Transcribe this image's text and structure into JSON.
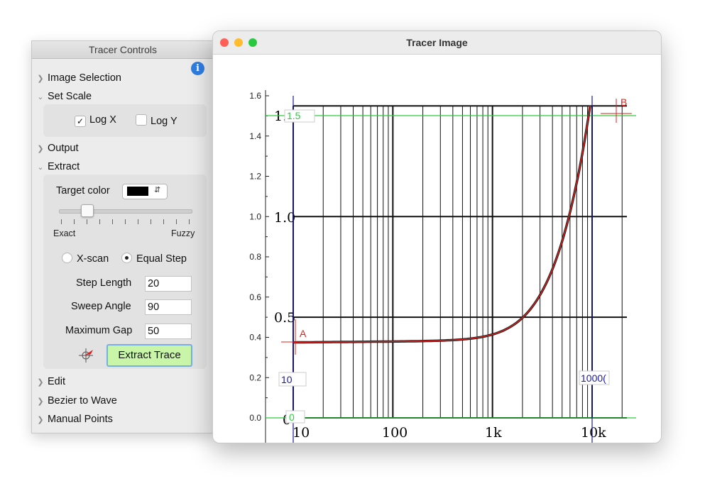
{
  "controls": {
    "title": "Tracer Controls",
    "info_icon": "i",
    "sections": {
      "image_selection": "Image Selection",
      "set_scale": "Set Scale",
      "output": "Output",
      "extract": "Extract",
      "edit": "Edit",
      "bezier": "Bezier to Wave",
      "manual_points": "Manual Points"
    },
    "scale": {
      "log_x_label": "Log X",
      "log_x_checked": true,
      "log_y_label": "Log Y",
      "log_y_checked": false
    },
    "extract": {
      "target_color_label": "Target color",
      "target_color_value": "#000000",
      "tolerance": 0.18,
      "tolerance_min_label": "Exact",
      "tolerance_max_label": "Fuzzy",
      "mode_xscan": "X-scan",
      "mode_equal_step": "Equal Step",
      "selected_mode": "Equal Step",
      "step_length_label": "Step Length",
      "step_length": "20",
      "sweep_angle_label": "Sweep Angle",
      "sweep_angle": "90",
      "max_gap_label": "Maximum Gap",
      "max_gap": "50",
      "extract_button": "Extract Trace"
    }
  },
  "window": {
    "title": "Tracer Image",
    "traffic_lights": {
      "close": "#ff5f57",
      "minimize": "#febc2e",
      "zoom": "#28c840"
    }
  },
  "plot": {
    "y_ticks": [
      "0.0",
      "0.2",
      "0.4",
      "0.6",
      "0.8",
      "1.0",
      "1.2",
      "1.4",
      "1.6"
    ],
    "x_ticks": [
      {
        "base": "10",
        "exp": "1"
      },
      {
        "base": "10",
        "exp": "2"
      },
      {
        "base": "10",
        "exp": "3"
      },
      {
        "base": "10",
        "exp": "4"
      }
    ],
    "image_labels": {
      "y_1_0": "1.0",
      "y_1_5": "1.",
      "y_0_5": "0.5",
      "y_0": "0",
      "x_10": "10",
      "x_100": "100",
      "x_1k": "1k",
      "x_10k": "10k"
    },
    "markers": {
      "a": "A",
      "b": "B",
      "y_cal_high": "1.5",
      "y_cal_low": "0",
      "x_cal_low": "10",
      "x_cal_high": "1000("
    },
    "colors": {
      "trace": "#e0201c",
      "y_cal": "#2ecc40",
      "x_cal": "#1a1aa8",
      "marker": "#e0201c"
    }
  }
}
